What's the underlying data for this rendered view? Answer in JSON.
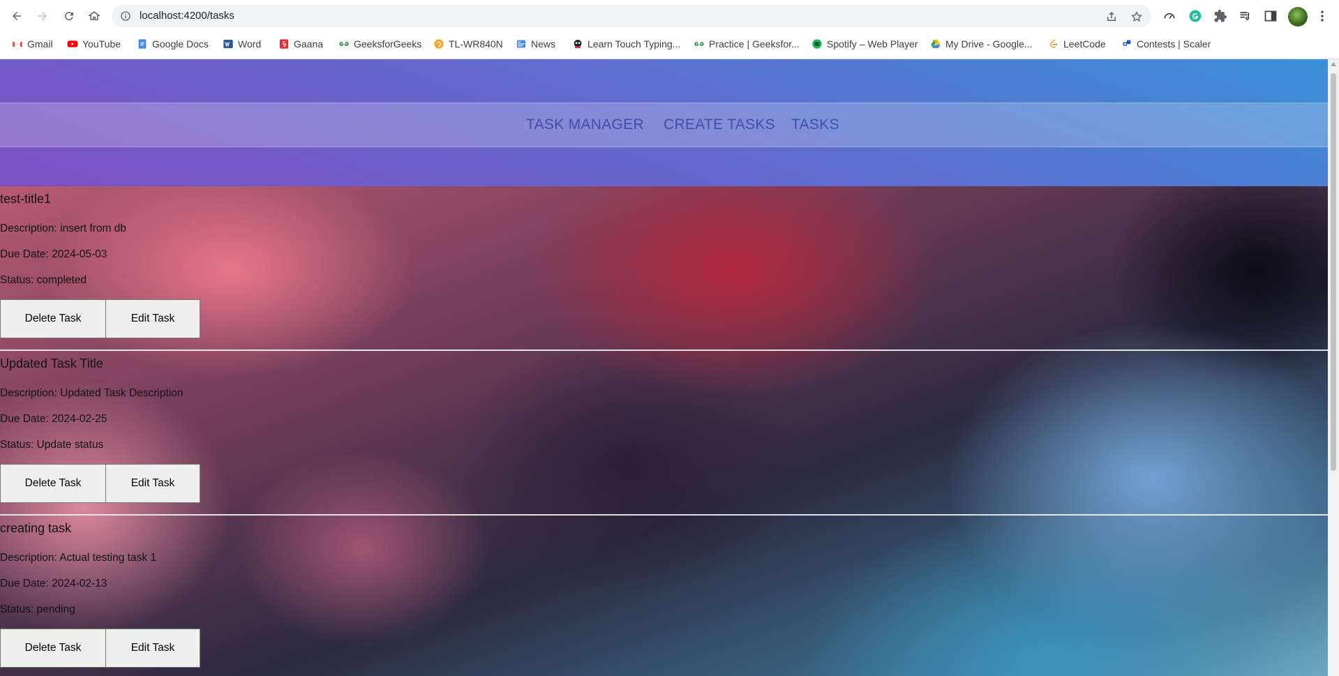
{
  "browser": {
    "url": "localhost:4200/tasks",
    "bookmarks": [
      {
        "label": "Gmail",
        "icon": "gmail-icon"
      },
      {
        "label": "YouTube",
        "icon": "youtube-icon"
      },
      {
        "label": "Google Docs",
        "icon": "google-docs-icon"
      },
      {
        "label": "Word",
        "icon": "word-icon"
      },
      {
        "label": "Gaana",
        "icon": "gaana-icon"
      },
      {
        "label": "GeeksforGeeks",
        "icon": "geeksforgeeks-icon"
      },
      {
        "label": "TL-WR840N",
        "icon": "tplink-icon"
      },
      {
        "label": "News",
        "icon": "google-news-icon"
      },
      {
        "label": "Learn Touch Typing...",
        "icon": "typing-icon"
      },
      {
        "label": "Practice | Geeksfor...",
        "icon": "geeksforgeeks-icon"
      },
      {
        "label": "Spotify – Web Player",
        "icon": "spotify-icon"
      },
      {
        "label": "My Drive - Google...",
        "icon": "google-drive-icon"
      },
      {
        "label": "LeetCode",
        "icon": "leetcode-icon"
      },
      {
        "label": "Contests | Scaler",
        "icon": "scaler-icon"
      }
    ]
  },
  "nav": {
    "brand": "TASK MANAGER",
    "create": "CREATE TASKS",
    "tasks": "TASKS"
  },
  "tasks": [
    {
      "title": "test-title1",
      "description": "Description: insert from db",
      "due": "Due Date: 2024-05-03",
      "status": "Status: completed",
      "delete_label": "Delete Task",
      "edit_label": "Edit Task"
    },
    {
      "title": "Updated Task Title",
      "description": "Description: Updated Task Description",
      "due": "Due Date: 2024-02-25",
      "status": "Status: Update status",
      "delete_label": "Delete Task",
      "edit_label": "Edit Task"
    },
    {
      "title": "creating task",
      "description": "Description: Actual testing task 1",
      "due": "Due Date: 2024-02-13",
      "status": "Status: pending",
      "delete_label": "Delete Task",
      "edit_label": "Edit Task"
    }
  ],
  "colors": {
    "nav_link": "#3f4ea8",
    "header_start": "#3a8fd8",
    "header_end": "#7e4fc2",
    "button_bg": "#efefef"
  }
}
